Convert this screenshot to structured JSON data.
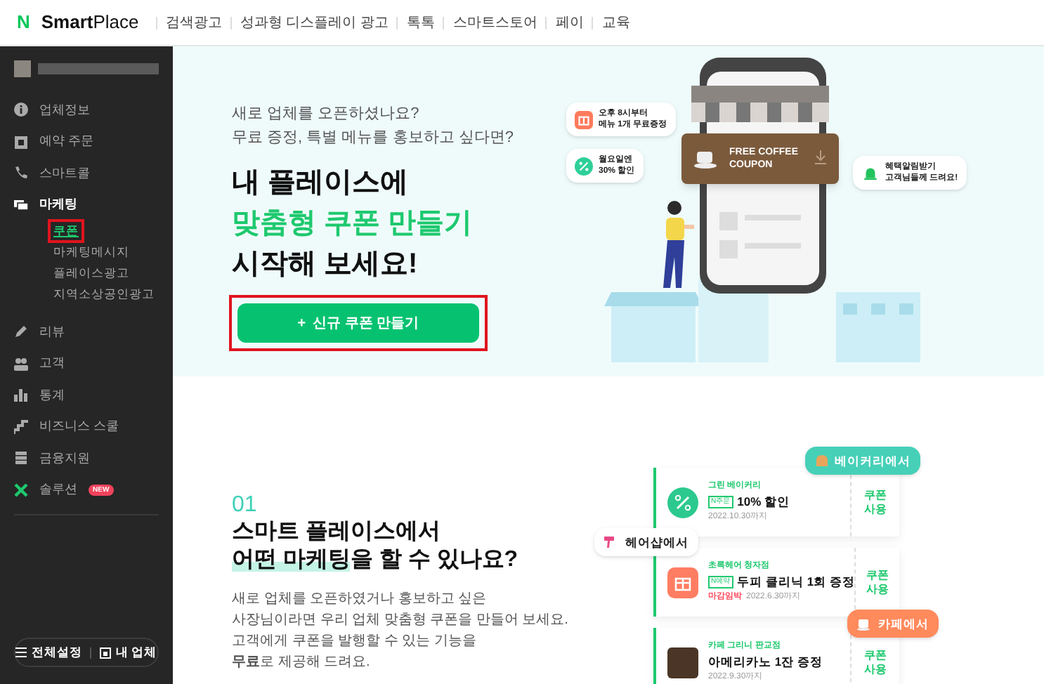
{
  "header": {
    "logo_mark": "N",
    "brand_bold": "Smart",
    "brand_light": "Place",
    "nav": [
      "검색광고",
      "성과형 디스플레이 광고",
      "톡톡",
      "스마트스토어",
      "페이",
      "교육"
    ]
  },
  "sidebar": {
    "items": [
      {
        "label": "업체정보",
        "selected": false
      },
      {
        "label": "예약 주문",
        "selected": false
      },
      {
        "label": "스마트콜",
        "selected": false
      },
      {
        "label": "마케팅",
        "selected": true,
        "expanded": true,
        "children": [
          {
            "label": "쿠폰",
            "selected": true,
            "highlighted": true
          },
          {
            "label": "마케팅메시지",
            "selected": false,
            "highlighted": false
          },
          {
            "label": "플레이스광고",
            "selected": false,
            "highlighted": false
          },
          {
            "label": "지역소상공인광고",
            "selected": false,
            "highlighted": false
          }
        ]
      },
      {
        "label": "리뷰",
        "selected": false
      },
      {
        "label": "고객",
        "selected": false
      },
      {
        "label": "통계",
        "selected": false
      },
      {
        "label": "비즈니스 스쿨",
        "selected": false
      },
      {
        "label": "금융지원",
        "selected": false
      },
      {
        "label": "솔루션",
        "selected": false,
        "badge": "NEW"
      }
    ],
    "footer": [
      "전체설정",
      "내 업체"
    ]
  },
  "hero": {
    "intro": [
      "새로 업체를 오픈하셨나요?",
      "무료 증정, 특별 메뉴를 홍보하고 싶다면?"
    ],
    "headline": [
      {
        "text": "내 플레이스에",
        "accent": false
      },
      {
        "text": "맞춤형 쿠폰 만들기",
        "accent": true
      },
      {
        "text": "시작해 보세요!",
        "accent": false
      }
    ],
    "button": {
      "icon": "+",
      "label": "신규 쿠폰 만들기",
      "highlighted": true
    },
    "bubbles": [
      {
        "lines": [
          "오후 8시부터",
          "메뉴 1개 무료증정"
        ]
      },
      {
        "lines": [
          "월요일엔",
          "30% 할인"
        ]
      },
      {
        "lines": [
          "혜택알림받기",
          "고객님들께 드려요!"
        ]
      }
    ],
    "coupon": [
      "FREE COFFEE",
      "COUPON"
    ]
  },
  "section": {
    "number": "01",
    "title_line1": "스마트 플레이스에서",
    "title_highlight": "어떤 마케팅",
    "title_rest": "을 할 수 있나요?",
    "body": [
      "새로 업체를 오픈하였거나 홍보하고 싶은",
      "사장님이라면 우리 업체 맞춤형 쿠폰을 만들어 보세요.",
      "고객에게 쿠폰을 발행할 수 있는 기능을",
      "**무료**로 제공해 드려요."
    ],
    "cards": [
      {
        "store": "그린 베이커리",
        "badge": "N주문",
        "title": "10% 할인",
        "date": "2022.10.30까지",
        "action": [
          "쿠폰",
          "사용"
        ]
      },
      {
        "store": "초록헤어 청자점",
        "badge": "N예약",
        "title": "두피 클리닉 1회 증정",
        "urgent": "마감임박",
        "date": "2022.6.30까지",
        "action": [
          "쿠폰",
          "사용"
        ]
      },
      {
        "store": "카페 그리니 판교점",
        "title": "아메리카노 1잔 증정",
        "date": "2022.9.30까지",
        "action": [
          "쿠폰",
          "사용"
        ]
      }
    ],
    "tags": [
      {
        "label": "베이커리에서",
        "color": "#46d0b8"
      },
      {
        "label": "헤어샵에서",
        "color": "#ffffff"
      },
      {
        "label": "카페에서",
        "color": "#ff8a5c"
      }
    ]
  }
}
